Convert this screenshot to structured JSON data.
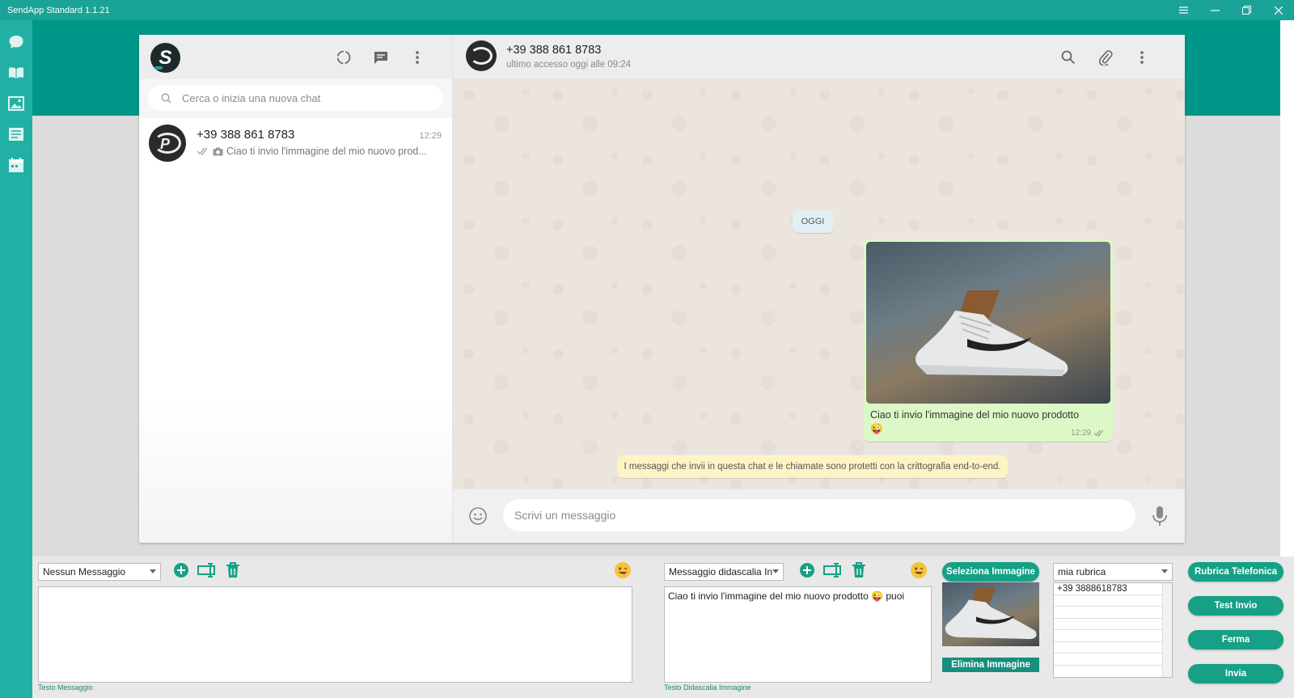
{
  "window": {
    "title": "SendApp Standard 1.1.21"
  },
  "colors": {
    "teal": "#009688",
    "accent": "#1aa397",
    "bubble_out": "#dcf8c6",
    "chat_bg": "#ece5dd",
    "button": "#16a085"
  },
  "sidebar": {
    "items": [
      {
        "icon": "chat-bubble-icon"
      },
      {
        "icon": "book-icon"
      },
      {
        "icon": "image-icon"
      },
      {
        "icon": "list-icon"
      },
      {
        "icon": "calendar-icon"
      }
    ]
  },
  "chat_list": {
    "search_placeholder": "Cerca o inizia una nuova chat",
    "chats": [
      {
        "name": "+39 388 861 8783",
        "time": "12:29",
        "preview": "Ciao ti invio l'immagine del mio nuovo prod..."
      }
    ]
  },
  "conversation": {
    "contact_name": "+39 388 861 8783",
    "status": "ultimo accesso oggi alle 09:24",
    "date_chip": "OGGI",
    "message": {
      "text": "Ciao ti invio l'immagine del mio nuovo prodotto",
      "emoji": "😜",
      "time": "12:29"
    },
    "e2e_notice": "I messaggi che invii in questa chat e le chiamate sono protetti con la crittografia end-to-end.",
    "compose_placeholder": "Scrivi un messaggio"
  },
  "controls": {
    "message_select": "Nessun Messaggio",
    "message_label": "Testo Messaggio",
    "caption_select": "Messaggio didascalia In",
    "caption_text": "Ciao ti invio l'immagine del mio nuovo prodotto 😜 puoi",
    "caption_label": "Testo Didascalia Immagine",
    "select_image": "Seleziona Immagine",
    "delete_image": "Elimina Immagine",
    "phonebook_select": "mia rubrica",
    "numbers": [
      "+39 3888618783",
      "",
      "",
      "",
      "",
      "",
      ""
    ],
    "phonebook_button": "Rubrica Telefonica",
    "test_button": "Test Invio",
    "stop_button": "Ferma",
    "send_button": "Invia"
  }
}
